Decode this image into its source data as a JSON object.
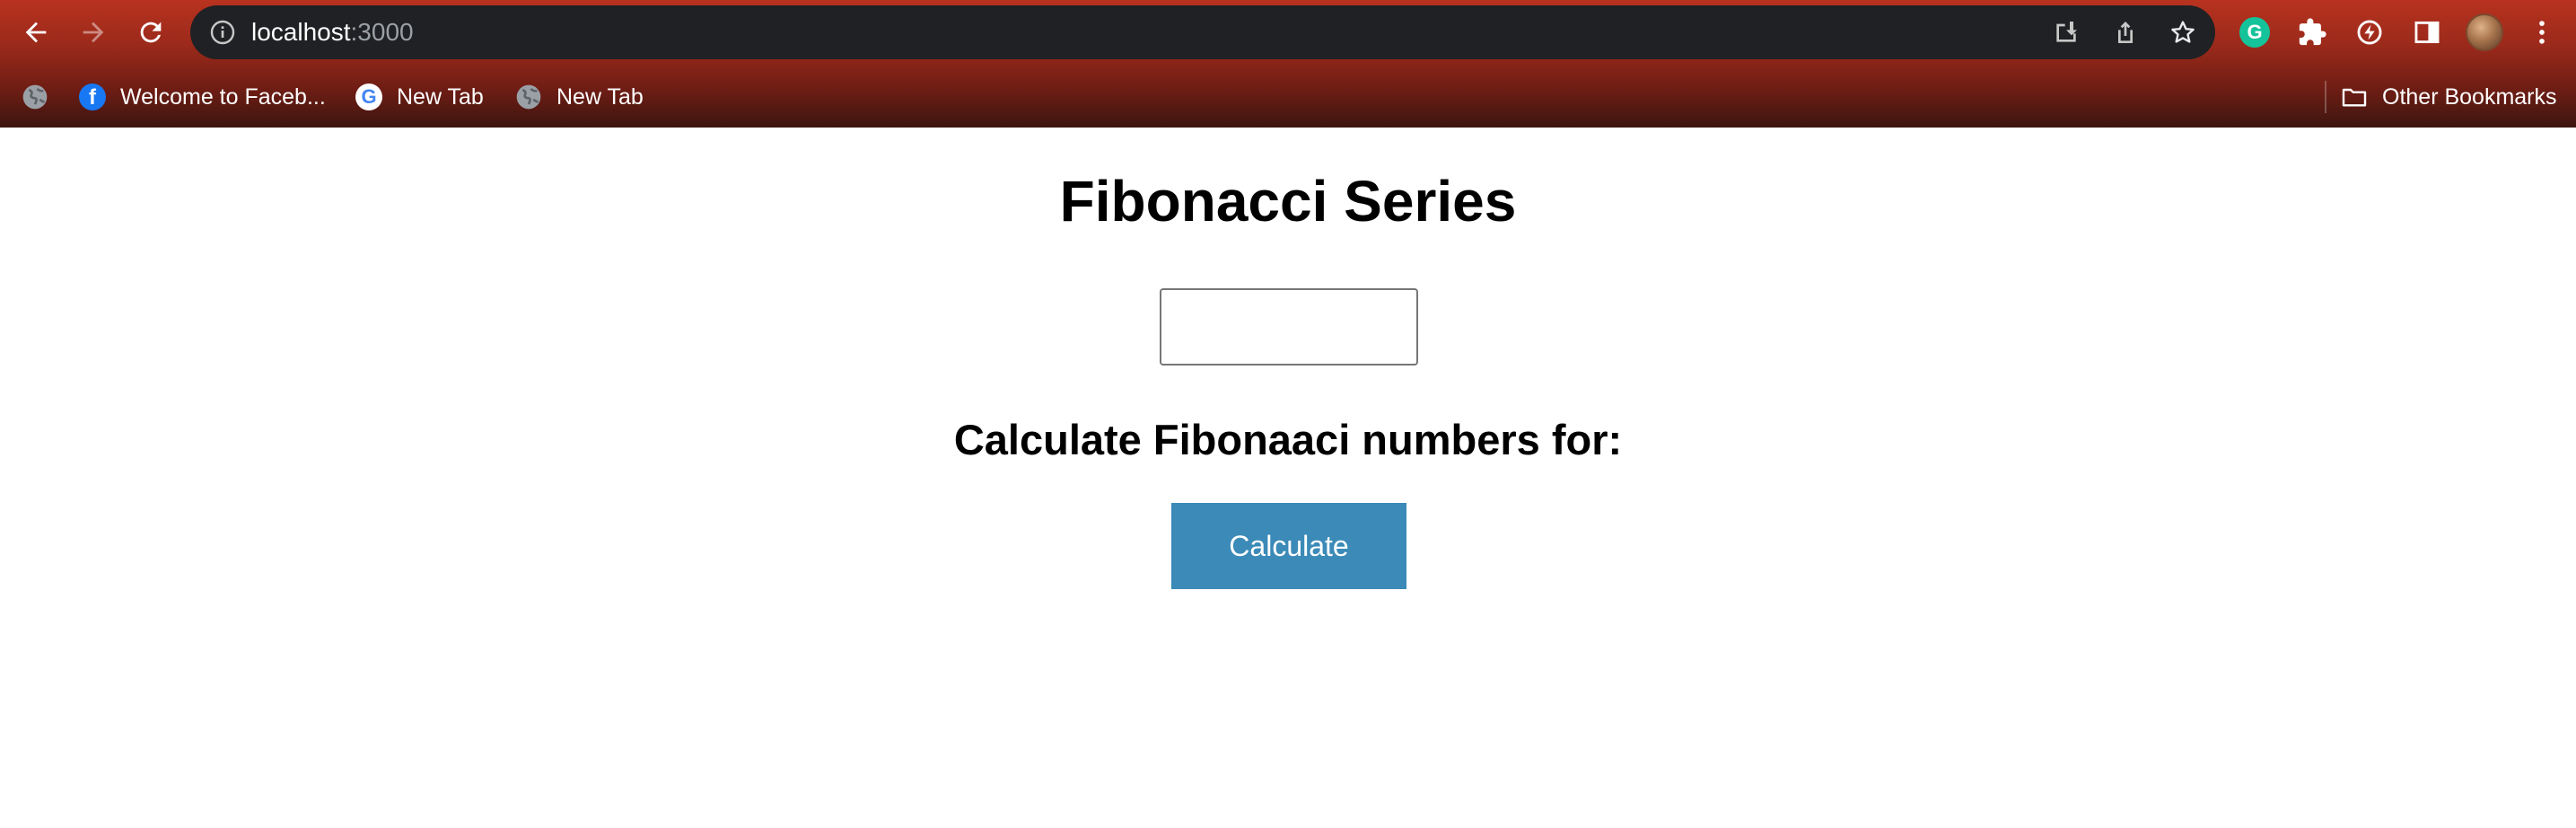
{
  "browser": {
    "url_host": "localhost",
    "url_port": ":3000",
    "bookmarks": [
      {
        "label": "",
        "icon": "globe-icon"
      },
      {
        "label": "Welcome to Faceb...",
        "icon": "facebook-icon"
      },
      {
        "label": "New Tab",
        "icon": "google-icon"
      },
      {
        "label": "New Tab",
        "icon": "globe-icon"
      }
    ],
    "other_bookmarks_label": "Other Bookmarks",
    "grammarly_letter": "G",
    "facebook_letter": "f",
    "google_letter": "G"
  },
  "page": {
    "title": "Fibonacci Series",
    "input_value": "",
    "subtitle": "Calculate Fibonaaci numbers for:",
    "button_label": "Calculate"
  },
  "colors": {
    "chrome_top": "#b8321f",
    "chrome_bottom": "#3d1510",
    "omnibox_bg": "#202124",
    "button_bg": "#3b8ab8"
  }
}
